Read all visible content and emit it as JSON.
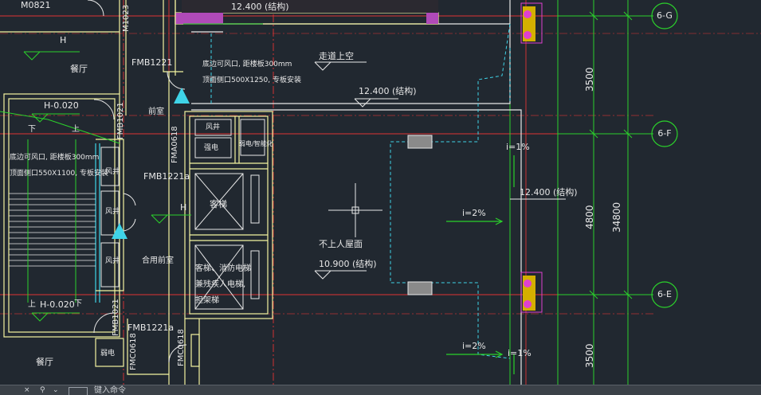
{
  "colors": {
    "background": "#212830",
    "wall": "#f4f4a0",
    "grid": "#e03434",
    "cyan": "#3fd4e8",
    "green": "#2bd12b",
    "white": "#e8e8e8",
    "purple": "#b04ab8",
    "magenta": "#e040d0",
    "gold": "#d4b000"
  },
  "axis_labels": [
    "6-G",
    "6-F",
    "6-E"
  ],
  "dimensions": {
    "d1": "3500",
    "d2": "4800",
    "d3": "3500",
    "total": "34800"
  },
  "labels": {
    "m0821": "M0821",
    "m1023": "M1023",
    "h_top": "H",
    "canting_top": "餐厅",
    "fmb1221_top": "FMB1221",
    "elev_124_top": "12.400 (结构)",
    "zoulang": "走道上空",
    "elev_124_mid": "12.400 (结构)",
    "duct_note1": "底边可风口, 距楼板300mm",
    "duct_note2": "顶面侧口500X1250, 专板安装",
    "qianshi": "前室",
    "h_neg_top": "H-0.020",
    "xia": "下",
    "shang": "上",
    "fmb1021": "FMB1021",
    "fengjing1": "风井",
    "pengdian": "强电",
    "ruodian": "弱电/智能化",
    "fma0618": "FMA0618",
    "duct_note3": "底边可风口, 距楼板300mm",
    "duct_note4": "顶面侧口550X1100, 专板安装",
    "fengjing2": "风井",
    "fengjing3": "风井",
    "fmb1221a": "FMB1221a",
    "h_mid": "H",
    "keti": "客梯",
    "slope1": "i=1%",
    "slope2": "i=2%",
    "elev_124_right": "12.400 (结构)",
    "buren": "不上人屋面",
    "elev_109": "10.900 (结构)",
    "hebing_qianshi": "合用前室",
    "fengjing4": "风井",
    "elevator_note1": "客梯、消防电梯",
    "elevator_note2": "兼残疾人电梯,",
    "elevator_note3": "担架梯",
    "shang2": "上",
    "h_neg_bot": "H-0.020",
    "xia2": "下",
    "fmb1021_b": "FMB1021",
    "fmb1221a_b": "FMB1221a",
    "ruodian_b": "弱电",
    "fmc0618": "FMC0618",
    "fmc0618_b": "FMC0618",
    "slope3": "i=2%",
    "slope4": "i=1%",
    "canting_bot": "餐厅"
  },
  "cmdbar": {
    "btn1": "×",
    "btn2": "⚲",
    "btn3": "⌄",
    "text": "键入命令"
  }
}
